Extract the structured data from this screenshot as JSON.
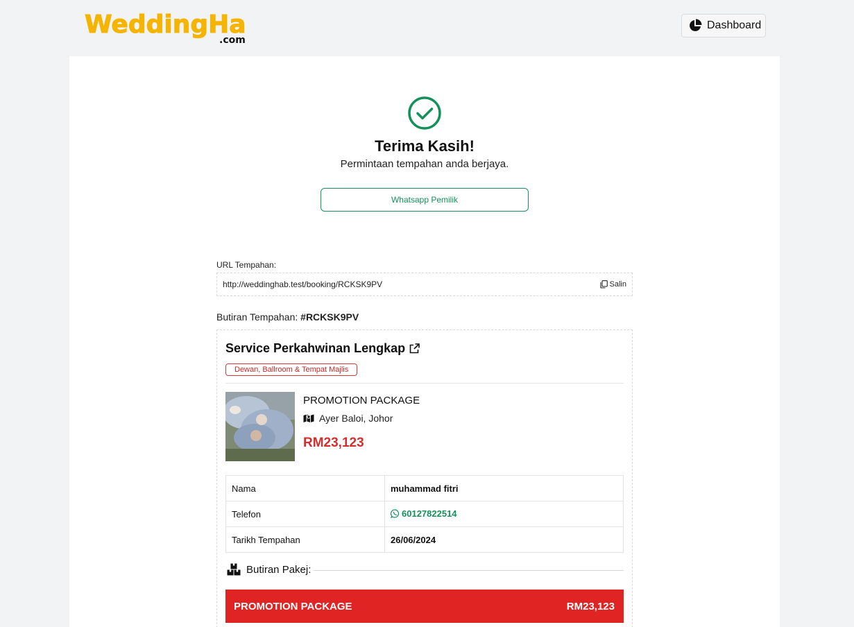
{
  "header": {
    "logo_text": "WeddingHab",
    "logo_suffix": ".com",
    "dashboard_label": "Dashboard"
  },
  "success": {
    "title": "Terima Kasih!",
    "message": "Permintaan tempahan anda berjaya.",
    "whatsapp_label": "Whatsapp Pemilik"
  },
  "booking_url": {
    "label": "URL Tempahan:",
    "value": "http://weddinghab.test/booking/RCKSK9PV",
    "copy_label": "Salin"
  },
  "booking": {
    "label": "Butiran Tempahan:",
    "code": "#RCKSK9PV",
    "service_title": "Service Perkahwinan Lengkap",
    "category": "Dewan, Ballroom & Tempat Majlis",
    "package_name": "PROMOTION PACKAGE",
    "location": "Ayer Baloi, Johor",
    "price": "RM23,123",
    "details": [
      {
        "key": "Nama",
        "value": "muhammad fitri"
      },
      {
        "key": "Telefon",
        "value": "60127822514"
      },
      {
        "key": "Tarikh Tempahan",
        "value": "26/06/2024"
      }
    ],
    "package_section_label": "Butiran Pakej:",
    "package_bar": {
      "name": "PROMOTION PACKAGE",
      "price": "RM23,123"
    }
  },
  "colors": {
    "brand_yellow": "#f5b400",
    "success_green": "#14915a",
    "accent_red": "#e02424"
  },
  "icons": [
    "dashboard-pie-icon",
    "check-circle-icon",
    "copy-icon",
    "external-link-icon",
    "map-icon",
    "whatsapp-icon",
    "boxes-icon"
  ]
}
